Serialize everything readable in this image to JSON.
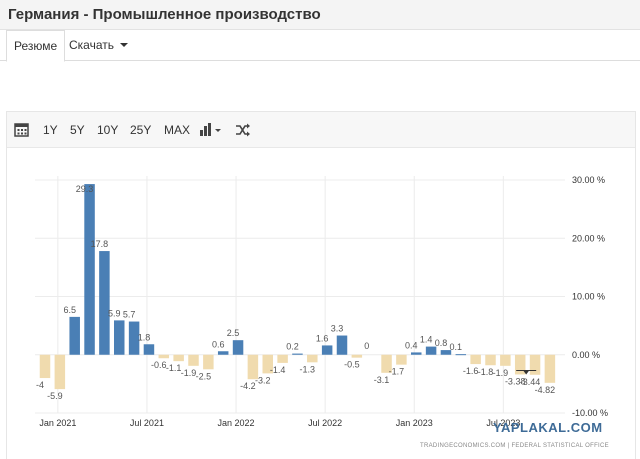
{
  "page": {
    "title": "Германия - Промышленное производство"
  },
  "tabs": [
    {
      "label": "Резюме"
    },
    {
      "label": "Скачать"
    }
  ],
  "toolbar": {
    "ranges": [
      "1Y",
      "5Y",
      "10Y",
      "25Y",
      "MAX"
    ],
    "icons": [
      "calendar-icon",
      "bar-chart-icon",
      "shuffle-icon"
    ]
  },
  "chart_data": {
    "type": "bar",
    "title": "",
    "xlabel": "",
    "ylabel": "",
    "categories": [
      "Dec 2020",
      "Jan 2021",
      "Feb 2021",
      "Mar 2021",
      "Apr 2021",
      "May 2021",
      "Jun 2021",
      "Jul 2021",
      "Aug 2021",
      "Sep 2021",
      "Oct 2021",
      "Nov 2021",
      "Dec 2021",
      "Jan 2022",
      "Feb 2022",
      "Mar 2022",
      "Apr 2022",
      "May 2022",
      "Jun 2022",
      "Jul 2022",
      "Aug 2022",
      "Sep 2022",
      "Oct 2022",
      "Nov 2022",
      "Dec 2022",
      "Jan 2023",
      "Feb 2023",
      "Mar 2023",
      "Apr 2023",
      "May 2023",
      "Jun 2023",
      "Jul 2023",
      "Aug 2023",
      "Sep 2023",
      "Oct 2023"
    ],
    "values": [
      -4,
      -5.9,
      6.5,
      29.3,
      17.8,
      5.9,
      5.7,
      1.8,
      -0.6,
      -1.1,
      -1.9,
      -2.5,
      0.6,
      2.5,
      -4.2,
      -3.2,
      -1.4,
      0.2,
      -1.3,
      1.6,
      3.3,
      -0.5,
      0,
      -3.1,
      -1.7,
      0.4,
      1.4,
      0.8,
      0.1,
      -1.6,
      -1.8,
      -1.9,
      -3.38,
      -3.44,
      -4.82
    ],
    "data_labels": [
      "-4",
      "-5.9",
      "6.5",
      "29.3",
      "17.8",
      "5.9",
      "5.7",
      "1.8",
      "-0.6",
      "-1.1",
      "-1.9",
      "-2.5",
      "0.6",
      "2.5",
      "-4.2",
      "-3.2",
      "-1.4",
      "0.2",
      "-1.3",
      "1.6",
      "3.3",
      "-0.5",
      "0",
      "-3.1",
      "-1.7",
      "0.4",
      "1.4",
      "0.8",
      "0.1",
      "-1.6",
      "-1.8",
      "-1.9",
      "-3.38",
      "-3.44",
      "-4.82"
    ],
    "x_tick_labels": [
      "Jan 2021",
      "Jul 2021",
      "Jan 2022",
      "Jul 2022",
      "Jan 2023",
      "Jul 2023"
    ],
    "y_tick_labels": [
      "30.00 %",
      "20.00 %",
      "10.00 %",
      "0.00 %",
      "-10.00 %"
    ],
    "y_ticks": [
      30,
      20,
      10,
      0,
      -10
    ],
    "ylim": [
      -10,
      30
    ],
    "grid": true,
    "colors": {
      "positive": "#4a7fb5",
      "negative": "#f0dbae",
      "grid": "#ececec"
    },
    "forecast_marker_value": -3.38
  },
  "source": "TRADINGECONOMICS.COM | FEDERAL STATISTICAL OFFICE",
  "watermark": "YAPLAKAL.COM"
}
